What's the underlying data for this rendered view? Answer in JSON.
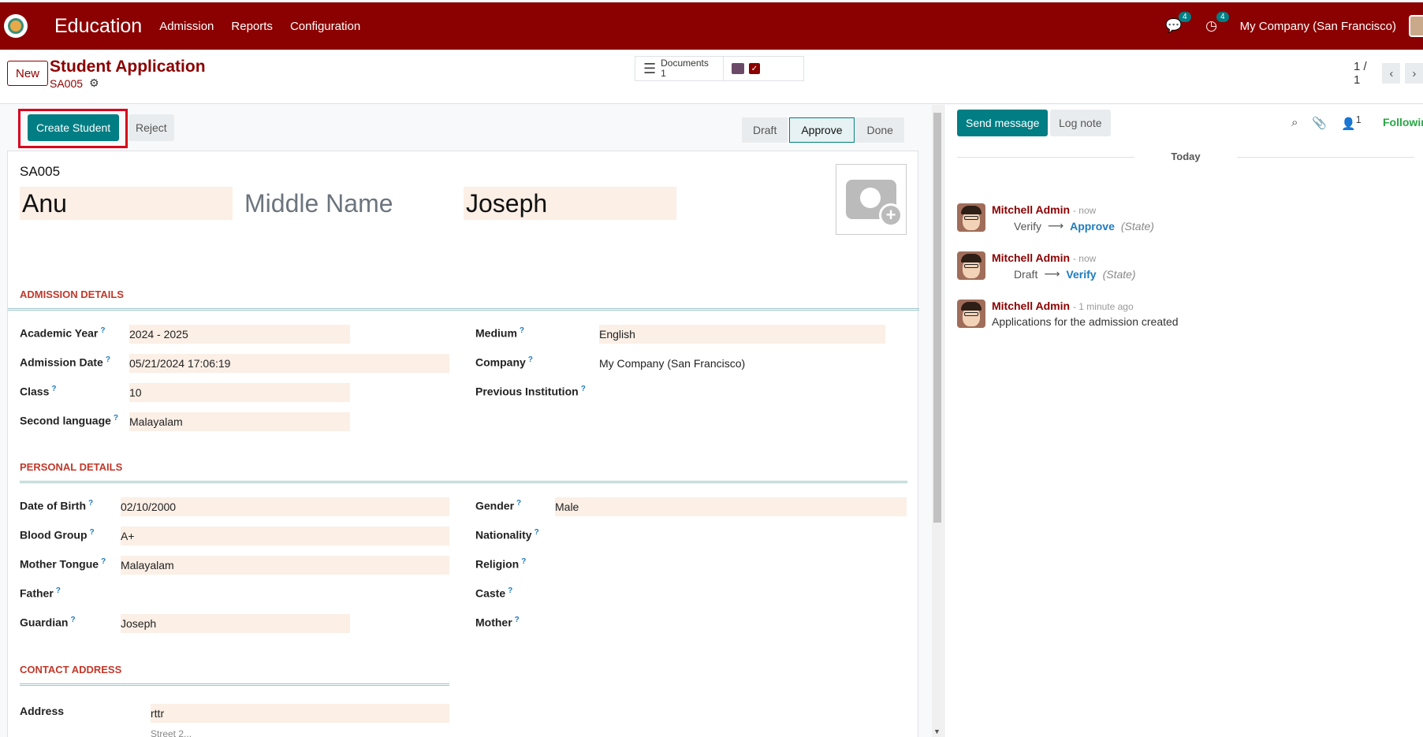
{
  "navbar": {
    "app_name": "Education",
    "menus": [
      "Admission",
      "Reports",
      "Configuration"
    ],
    "messages_count": "4",
    "activities_count": "4",
    "company": "My Company (San Francisco)"
  },
  "control": {
    "new_label": "New",
    "title": "Student Application",
    "record_ref": "SA005",
    "documents_label": "Documents",
    "documents_count": "1",
    "pager": "1 / 1"
  },
  "statusbar": {
    "create_label": "Create Student",
    "reject_label": "Reject",
    "stages": [
      "Draft",
      "Approve",
      "Done"
    ],
    "active_stage": "Approve"
  },
  "form": {
    "ref": "SA005",
    "first_name": "Anu",
    "middle_name_placeholder": "Middle Name",
    "last_name": "Joseph",
    "sections": {
      "admission": "ADMISSION DETAILS",
      "personal": "PERSONAL DETAILS",
      "contact": "CONTACT ADDRESS"
    },
    "admission": {
      "academic_year_label": "Academic Year",
      "academic_year": "2024 - 2025",
      "admission_date_label": "Admission Date",
      "admission_date": "05/21/2024 17:06:19",
      "class_label": "Class",
      "class": "10",
      "second_language_label": "Second language",
      "second_language": "Malayalam",
      "medium_label": "Medium",
      "medium": "English",
      "company_label": "Company",
      "company": "My Company (San Francisco)",
      "previous_institution_label": "Previous Institution"
    },
    "personal": {
      "dob_label": "Date of Birth",
      "dob": "02/10/2000",
      "blood_group_label": "Blood Group",
      "blood_group": "A+",
      "mother_tongue_label": "Mother Tongue",
      "mother_tongue": "Malayalam",
      "father_label": "Father",
      "guardian_label": "Guardian",
      "guardian": "Joseph",
      "gender_label": "Gender",
      "gender": "Male",
      "nationality_label": "Nationality",
      "religion_label": "Religion",
      "caste_label": "Caste",
      "mother_label": "Mother"
    },
    "contact": {
      "address_label": "Address",
      "address": "rttr",
      "street2_placeholder": "Street 2..."
    }
  },
  "chatter": {
    "send_label": "Send message",
    "log_label": "Log note",
    "followers_count": "1",
    "following_label": "Following",
    "today_label": "Today",
    "messages": [
      {
        "author": "Mitchell Admin",
        "time": "- now",
        "old": "Verify",
        "new": "Approve",
        "field": "(State)"
      },
      {
        "author": "Mitchell Admin",
        "time": "- now",
        "old": "Draft",
        "new": "Verify",
        "field": "(State)"
      },
      {
        "author": "Mitchell Admin",
        "time": "- 1 minute ago",
        "body": "Applications for the admission created"
      }
    ]
  },
  "colors": {
    "brand": "#8b0000",
    "primary": "#017e84",
    "input_bg": "#fbefe6"
  },
  "icons": [
    "apps-icon",
    "chat-icon",
    "clock-icon",
    "gear-icon",
    "documents-icon",
    "archive-icon",
    "checkbox-icon",
    "chevron-left-icon",
    "chevron-right-icon",
    "camera-plus-icon",
    "search-icon",
    "paperclip-icon",
    "user-icon"
  ]
}
